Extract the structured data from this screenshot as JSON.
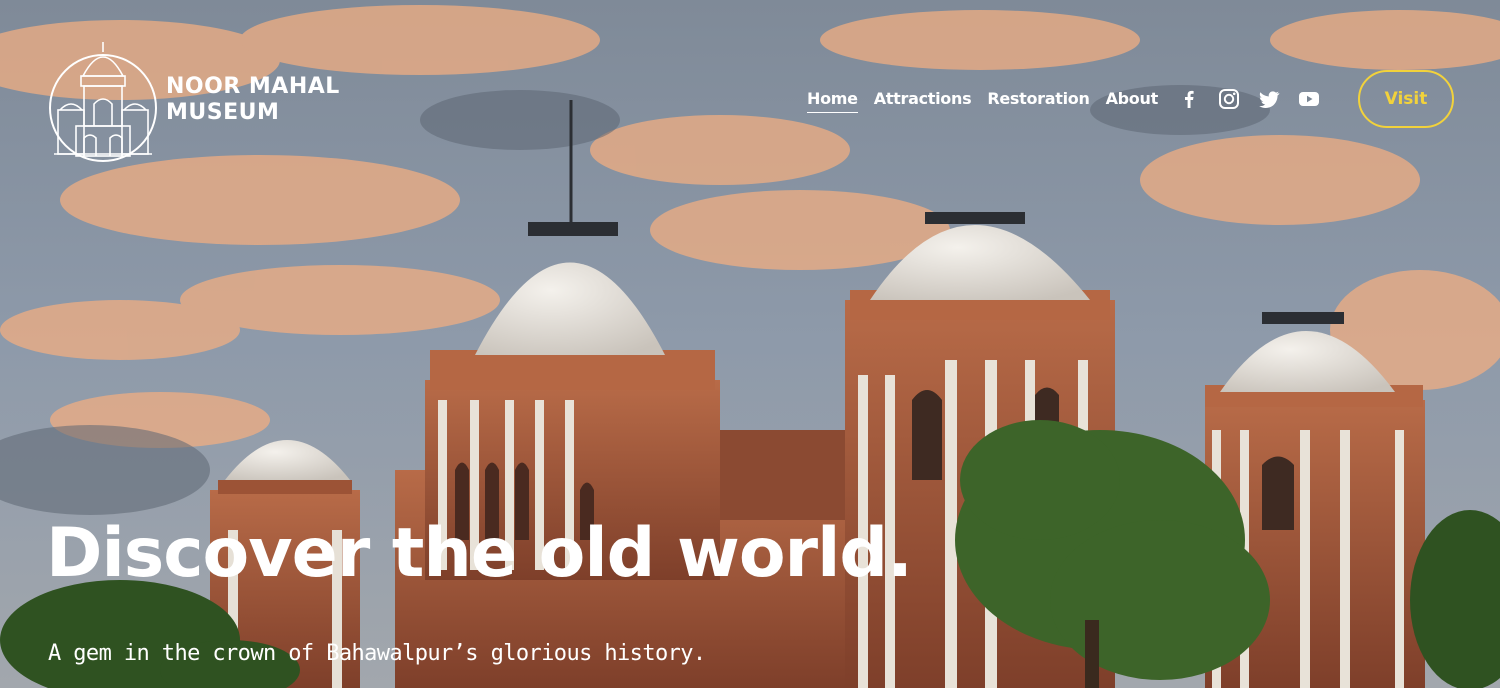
{
  "brand": {
    "line1": "NOOR MAHAL",
    "line2": "MUSEUM"
  },
  "nav": {
    "items": [
      {
        "label": "Home",
        "active": true
      },
      {
        "label": "Attractions",
        "active": false
      },
      {
        "label": "Restoration",
        "active": false
      },
      {
        "label": "About",
        "active": false
      }
    ]
  },
  "social": {
    "icons": [
      "facebook-icon",
      "instagram-icon",
      "twitter-icon",
      "youtube-icon"
    ]
  },
  "cta": {
    "visit_label": "Visit",
    "color": "#f2d23b"
  },
  "hero": {
    "title": "Discover the old world.",
    "subtitle": "A gem in the crown of Bahawalpur’s glorious history."
  },
  "colors": {
    "sky": "#8fa0b2",
    "cloud": "#f2b48a",
    "brick": "#a85a3c",
    "dome": "#ece8e2",
    "tree": "#3f6a2b"
  }
}
